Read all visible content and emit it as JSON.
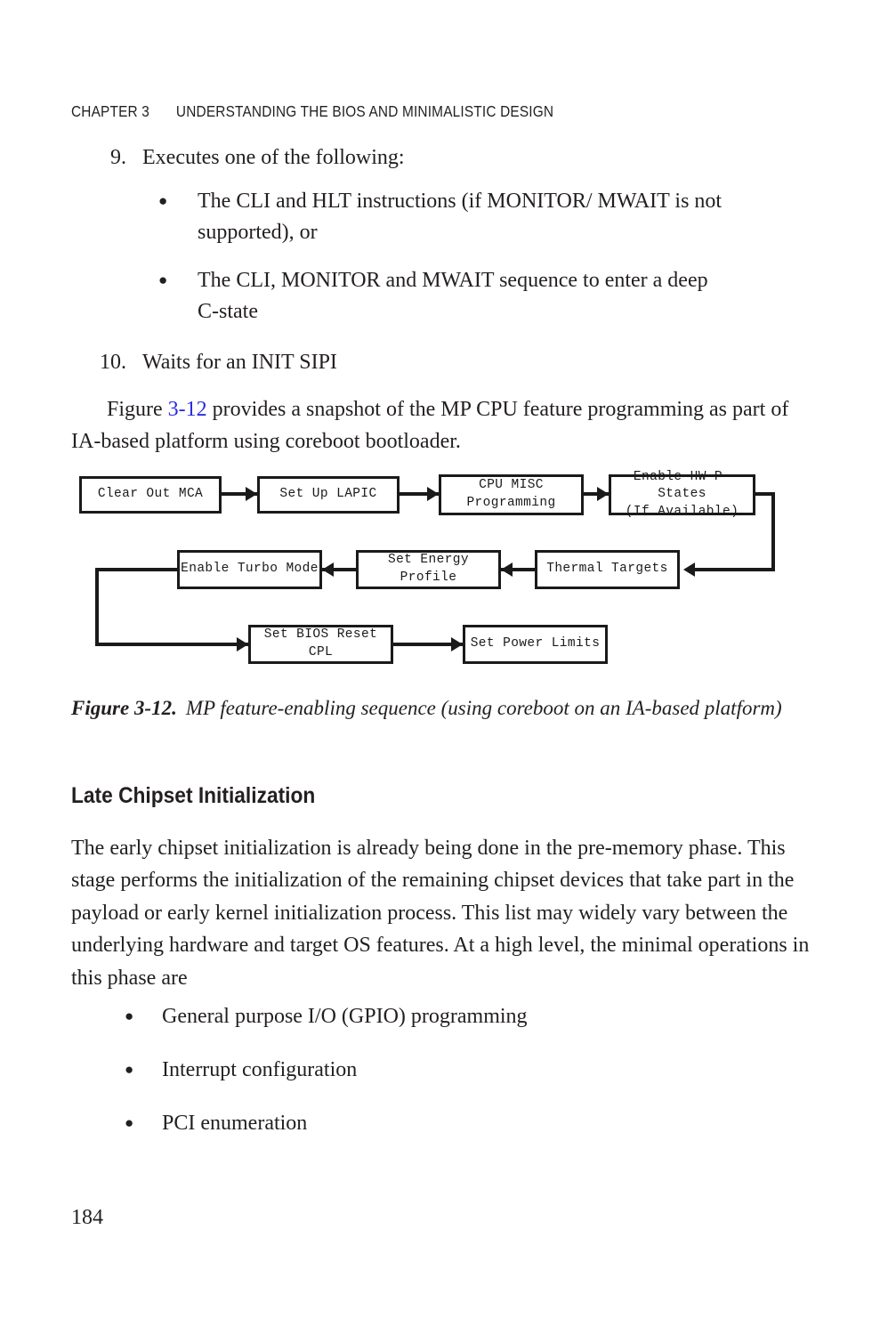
{
  "running_head": {
    "chapter_label": "CHAPTER 3",
    "title": "UNDERSTANDING THE BIOS AND MINIMALISTIC DESIGN"
  },
  "numbered_list": [
    {
      "number": "9.",
      "text": "Executes one of the following:",
      "sub_bullets": [
        "The CLI and HLT instructions (if MONITOR/ MWAIT is not supported), or",
        "The CLI, MONITOR and MWAIT sequence to enter a deep C-state"
      ]
    },
    {
      "number": "10.",
      "text": "Waits for an INIT SIPI",
      "sub_bullets": []
    }
  ],
  "figure_intro": {
    "before_ref": "Figure ",
    "ref": "3-12",
    "after_ref": " provides a snapshot of the MP CPU feature programming as part of IA-based platform using coreboot bootloader."
  },
  "flowchart": {
    "boxes": [
      {
        "id": "clear-out-mca",
        "label": "Clear Out MCA"
      },
      {
        "id": "set-up-lapic",
        "label": "Set Up LAPIC"
      },
      {
        "id": "cpu-misc-programming",
        "label_line1": "CPU MISC",
        "label_line2": "Programming"
      },
      {
        "id": "enable-hw-pstates",
        "label_line1": "Enable HW P-States",
        "label_line2": "(If Available)"
      },
      {
        "id": "thermal-targets",
        "label": "Thermal Targets"
      },
      {
        "id": "set-energy-profile",
        "label": "Set Energy Profile"
      },
      {
        "id": "enable-turbo-mode",
        "label": "Enable Turbo Mode"
      },
      {
        "id": "set-bios-reset-cpl",
        "label": "Set BIOS Reset CPL"
      },
      {
        "id": "set-power-limits",
        "label": "Set Power Limits"
      }
    ]
  },
  "caption": {
    "label": "Figure 3-12.",
    "text": "MP feature-enabling sequence (using coreboot on an IA-based platform)"
  },
  "heading": "Late Chipset Initialization",
  "body_paragraph": "The early chipset initialization is already being done in the pre-memory phase. This stage performs the initialization of the remaining chipset devices that take part in the payload or early kernel initialization process. This list may widely vary between the underlying hardware and target OS features. At a high level, the minimal operations in this phase are",
  "final_bullets": [
    "General purpose I/O (GPIO) programming",
    "Interrupt configuration",
    "PCI enumeration"
  ],
  "page_number": "184",
  "colors": {
    "text": "#231f20",
    "link": "#2a2adf",
    "diagram_stroke": "#1a1a1a"
  }
}
